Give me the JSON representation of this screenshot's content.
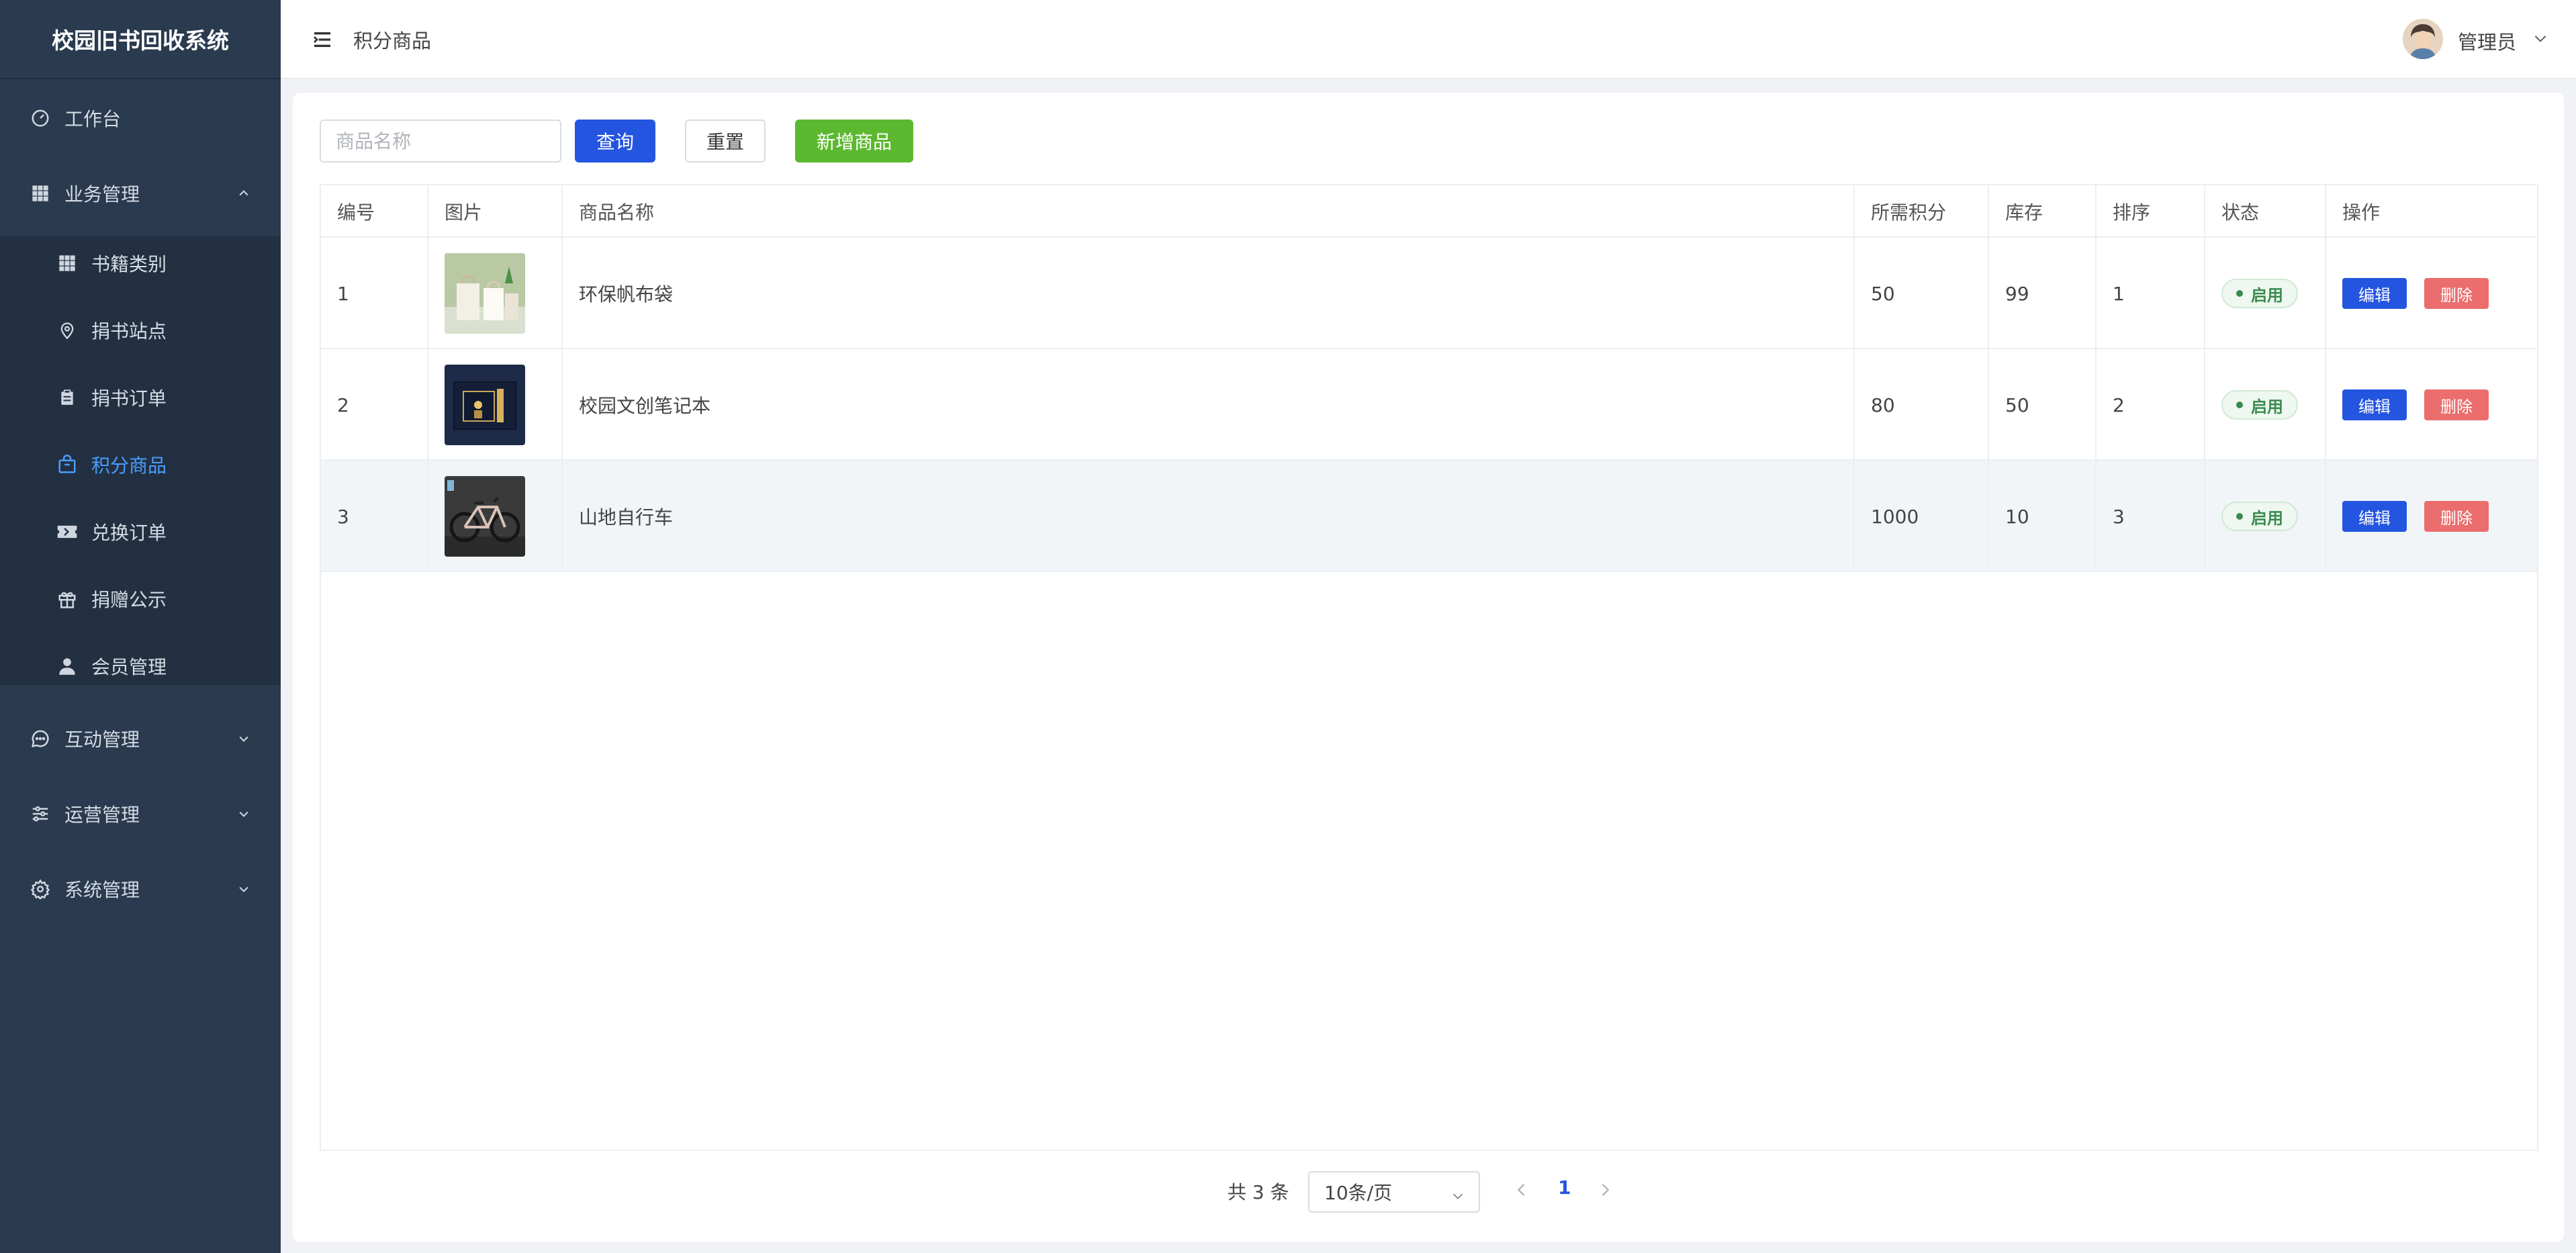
{
  "app": {
    "title": "校园旧书回收系统"
  },
  "sidebar": {
    "items": [
      {
        "label": "工作台",
        "icon": "dashboard-icon"
      },
      {
        "label": "业务管理",
        "icon": "grid-icon",
        "expanded": true
      },
      {
        "label": "书籍类别",
        "icon": "grid-icon"
      },
      {
        "label": "捐书站点",
        "icon": "location-icon"
      },
      {
        "label": "捐书订单",
        "icon": "clipboard-icon"
      },
      {
        "label": "积分商品",
        "icon": "shopping-bag-icon",
        "active": true
      },
      {
        "label": "兑换订单",
        "icon": "ticket-icon"
      },
      {
        "label": "捐赠公示",
        "icon": "gift-icon"
      },
      {
        "label": "会员管理",
        "icon": "user-icon"
      },
      {
        "label": "互动管理",
        "icon": "chat-icon"
      },
      {
        "label": "运营管理",
        "icon": "sliders-icon"
      },
      {
        "label": "系统管理",
        "icon": "gear-icon"
      }
    ]
  },
  "header": {
    "breadcrumb": "积分商品",
    "user": "管理员"
  },
  "toolbar": {
    "search_placeholder": "商品名称",
    "query_label": "查询",
    "reset_label": "重置",
    "add_label": "新增商品"
  },
  "table": {
    "columns": [
      "编号",
      "图片",
      "商品名称",
      "所需积分",
      "库存",
      "排序",
      "状态",
      "操作"
    ],
    "rows": [
      {
        "id": "1",
        "name": "环保帆布袋",
        "points": "50",
        "stock": "99",
        "sort": "1",
        "status": "启用"
      },
      {
        "id": "2",
        "name": "校园文创笔记本",
        "points": "80",
        "stock": "50",
        "sort": "2",
        "status": "启用"
      },
      {
        "id": "3",
        "name": "山地自行车",
        "points": "1000",
        "stock": "10",
        "sort": "3",
        "status": "启用"
      }
    ],
    "edit_label": "编辑",
    "delete_label": "删除"
  },
  "pagination": {
    "total": "共 3 条",
    "page_size": "10条/页",
    "current_page": "1"
  },
  "colors": {
    "sidebar_bg": "#2a3a4f",
    "primary": "#2455e0",
    "success": "#5cb82f",
    "danger": "#ec6d6d",
    "active": "#4a9dff"
  }
}
